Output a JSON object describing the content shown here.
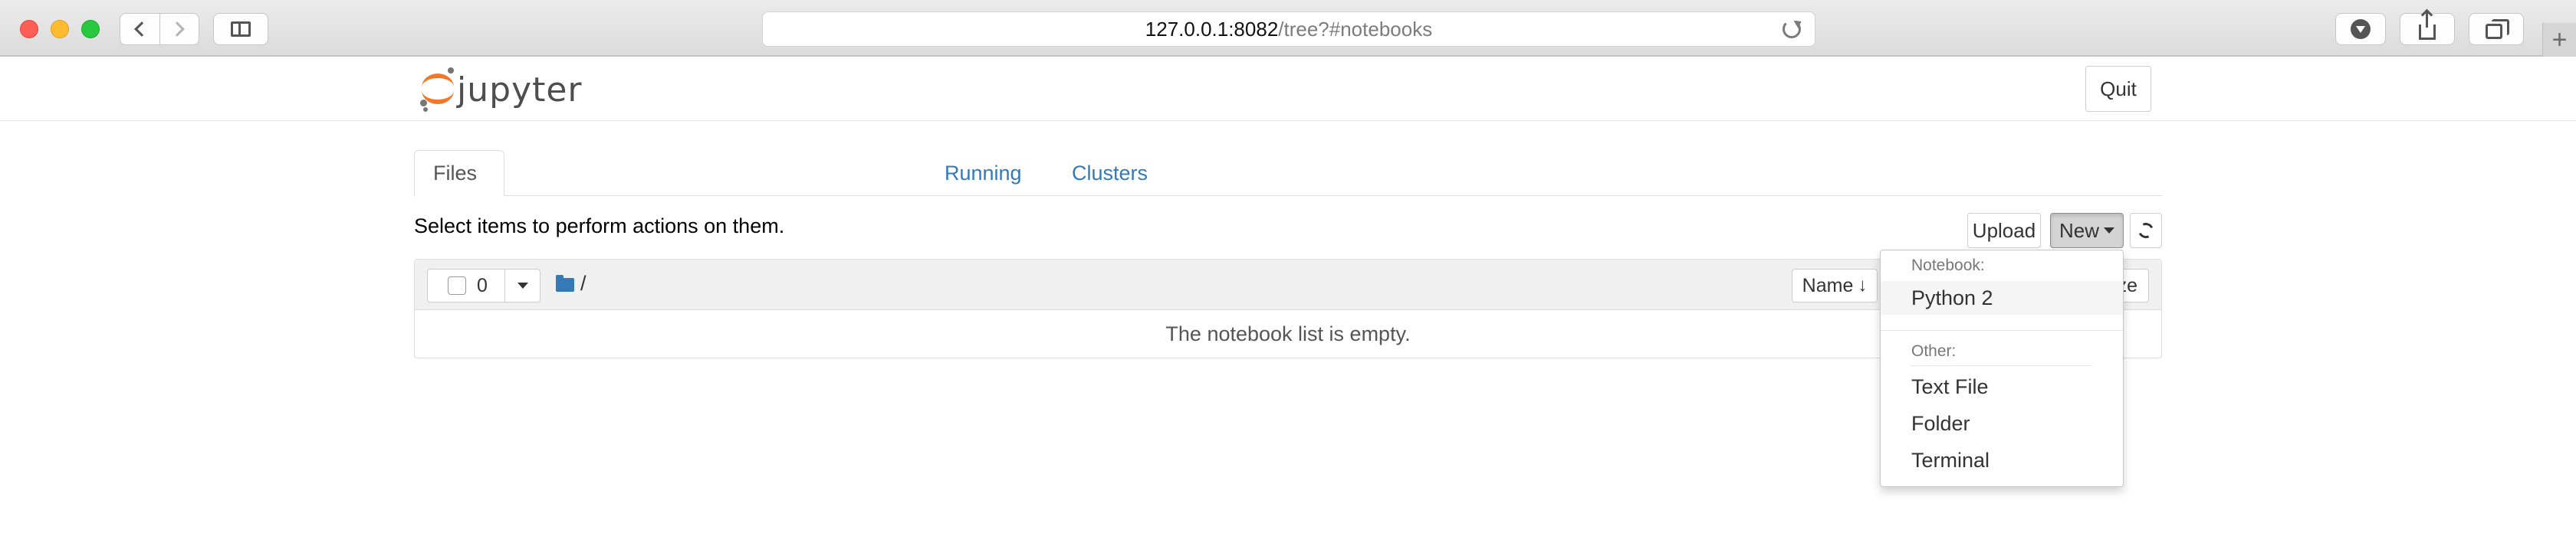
{
  "browser": {
    "url_host": "127.0.0.1:8082",
    "url_path": "/tree?#notebooks",
    "newtab_symbol": "+"
  },
  "header": {
    "logo_text": "jupyter",
    "quit_label": "Quit"
  },
  "tabs": [
    {
      "label": "Files"
    },
    {
      "label": "Running"
    },
    {
      "label": "Clusters"
    }
  ],
  "toolbar": {
    "hint": "Select items to perform actions on them.",
    "upload_label": "Upload",
    "new_label": "New"
  },
  "list": {
    "selected_count": "0",
    "path": "/",
    "sort_name_label": "Name",
    "sort_size_label": "ze",
    "empty_message": "The notebook list is empty."
  },
  "new_menu": {
    "notebook_header": "Notebook:",
    "notebook_items": [
      {
        "label": "Python 2"
      }
    ],
    "other_header": "Other:",
    "other_items": [
      {
        "label": "Text File"
      },
      {
        "label": "Folder"
      },
      {
        "label": "Terminal"
      }
    ]
  },
  "colors": {
    "link": "#337ab7",
    "logo_orange": "#f37726"
  }
}
